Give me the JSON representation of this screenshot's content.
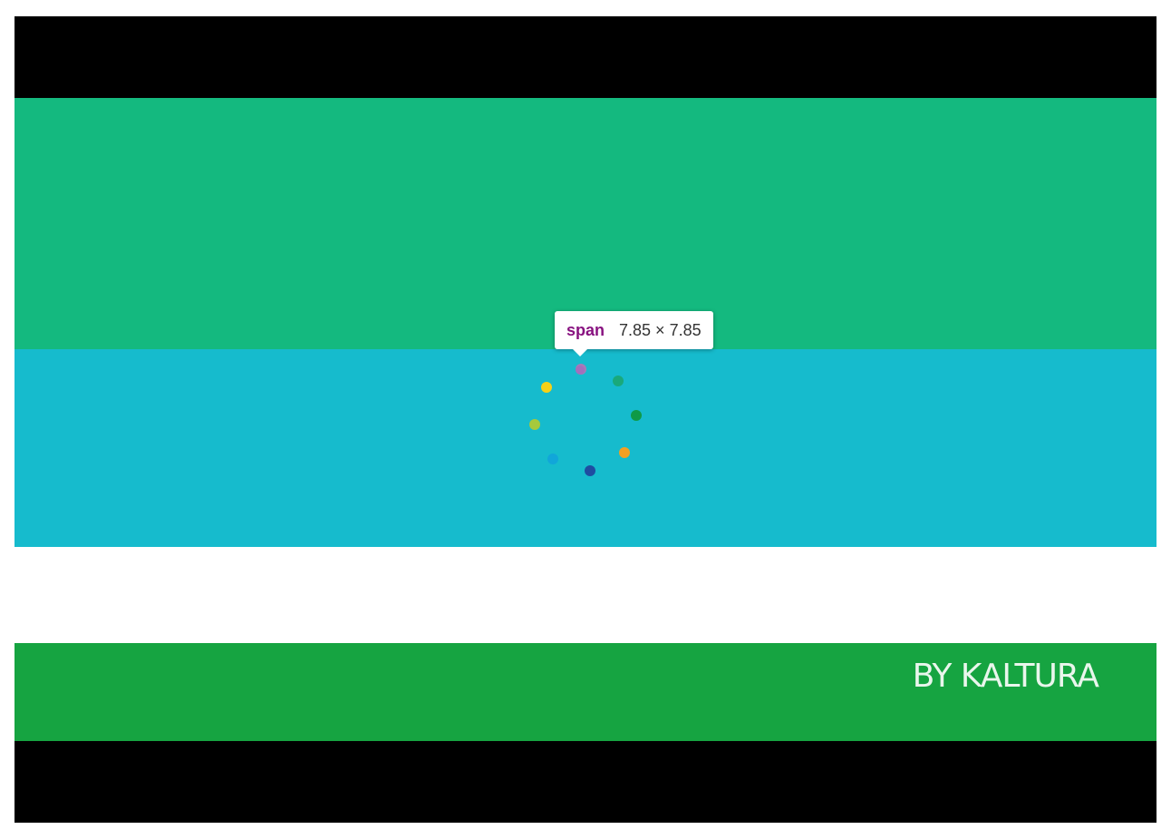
{
  "video": {
    "brand_text": "BY KALTURA",
    "colors": {
      "letterbox": "#000000",
      "top_band": "#14b97f",
      "middle_band": "#16bbcd",
      "white_band": "#ffffff",
      "bottom_band": "#16a441"
    }
  },
  "spinner": {
    "dots": [
      {
        "color": "#a87ab8"
      },
      {
        "color": "#19a97b"
      },
      {
        "color": "#0f9a47"
      },
      {
        "color": "#f2a023"
      },
      {
        "color": "#1e4da1"
      },
      {
        "color": "#11a6d9"
      },
      {
        "color": "#a6c93c"
      },
      {
        "color": "#f7d117"
      }
    ]
  },
  "devtools_tooltip": {
    "tag": "span",
    "size": "7.85 × 7.85"
  }
}
